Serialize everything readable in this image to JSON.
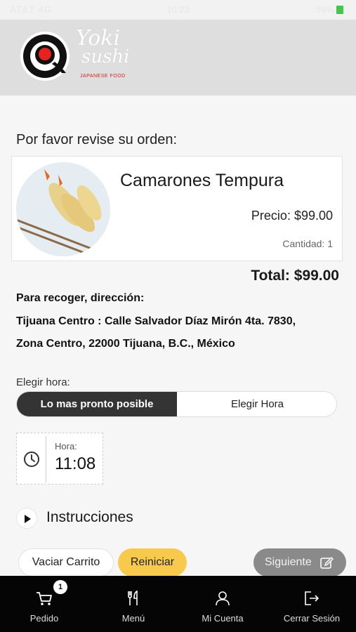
{
  "status_bar": {
    "carrier": "AT&T 4G",
    "time": "10:23",
    "battery": "59%"
  },
  "brand": {
    "name_line1": "Yoki",
    "name_line2": "sushi",
    "tagline": "JAPANESE FOOD"
  },
  "review": {
    "title": "Por favor revise su orden:"
  },
  "item": {
    "name": "Camarones Tempura",
    "price": "Precio: $99.00",
    "quantity": "Cantidad: 1"
  },
  "total": "Total: $99.00",
  "pickup": {
    "label": "Para recoger, dirección:",
    "address_line1": "Tijuana Centro : Calle Salvador Díaz Mirón 4ta. 7830,",
    "address_line2": "Zona Centro, 22000 Tijuana, B.C., México"
  },
  "schedule": {
    "label": "Elegir hora:",
    "option_asap": "Lo mas pronto posible",
    "option_choose": "Elegir Hora",
    "selected": "Lo mas pronto posible",
    "time_label": "Hora:",
    "time_value": "11:08"
  },
  "instructions": {
    "label": "Instrucciones"
  },
  "actions": {
    "empty_cart": "Vaciar Carrito",
    "reset": "Reiniciar",
    "next": "Siguiente"
  },
  "tabbar": {
    "cart_badge": "1",
    "items": [
      {
        "label": "Pedido",
        "icon": "cart-icon"
      },
      {
        "label": "Menú",
        "icon": "fork-knife-icon"
      },
      {
        "label": "Mi Cuenta",
        "icon": "user-icon"
      },
      {
        "label": "Cerrar Sesión",
        "icon": "logout-icon"
      }
    ]
  },
  "colors": {
    "header_bg": "#dedede",
    "segment_selected": "#343434",
    "reset_button": "#f7c94c",
    "next_button": "#8a8a8a",
    "tabbar_bg": "#050505",
    "logo_red": "#e8231e"
  }
}
